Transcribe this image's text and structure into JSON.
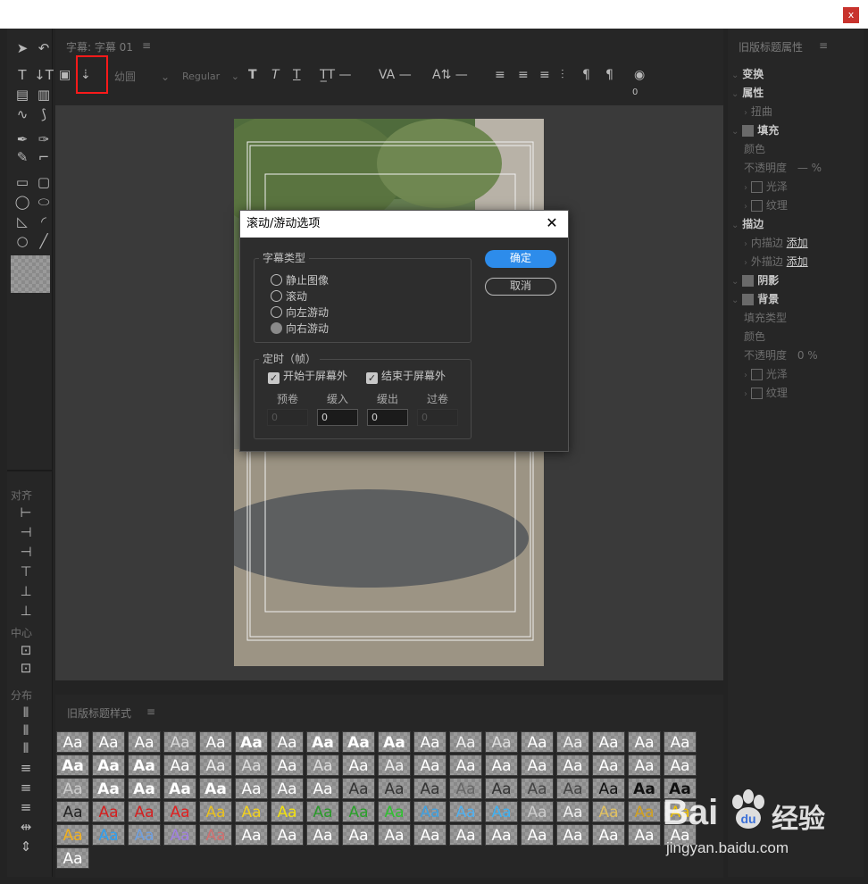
{
  "window": {
    "close_label": "x"
  },
  "title_panel": {
    "tab_label": "字幕: 字幕 01",
    "menu_glyph": "≡",
    "font_family": "幼圆",
    "font_style": "Regular",
    "kerning_value": "0"
  },
  "right_panel": {
    "title": "旧版标题属性",
    "menu_glyph": "≡",
    "items": [
      {
        "label": "变换",
        "kind": "head"
      },
      {
        "label": "属性",
        "kind": "head"
      },
      {
        "label": "扭曲",
        "kind": "sub"
      },
      {
        "label": "填充",
        "kind": "head-check"
      },
      {
        "label": "颜色",
        "kind": "field"
      },
      {
        "label": "不透明度",
        "kind": "field",
        "value": "— %"
      },
      {
        "label": "光泽",
        "kind": "sub-check"
      },
      {
        "label": "纹理",
        "kind": "sub-check"
      },
      {
        "label": "描边",
        "kind": "head"
      },
      {
        "label": "内描边",
        "kind": "sub",
        "link": "添加"
      },
      {
        "label": "外描边",
        "kind": "sub",
        "link": "添加"
      },
      {
        "label": "阴影",
        "kind": "head-check"
      },
      {
        "label": "背景",
        "kind": "head-check-on"
      },
      {
        "label": "填充类型",
        "kind": "field"
      },
      {
        "label": "颜色",
        "kind": "field"
      },
      {
        "label": "不透明度",
        "kind": "field",
        "value": "0 %"
      },
      {
        "label": "光泽",
        "kind": "sub-check"
      },
      {
        "label": "纹理",
        "kind": "sub-check"
      }
    ]
  },
  "left_panel": {
    "align_label": "对齐",
    "center_label": "中心",
    "distribute_label": "分布"
  },
  "styles_panel": {
    "title": "旧版标题样式",
    "menu_glyph": "≡",
    "swatch_text": "Aa",
    "swatch_count": 91
  },
  "dialog": {
    "title": "滚动/游动选项",
    "close_glyph": "✕",
    "type_group_label": "字幕类型",
    "options": [
      "静止图像",
      "滚动",
      "向左游动",
      "向右游动"
    ],
    "selected_option": "向右游动",
    "timing_group_label": "定时（帧）",
    "start_offscreen": "开始于屏幕外",
    "end_offscreen": "结束于屏幕外",
    "fields": [
      {
        "label": "预卷",
        "value": "0",
        "enabled": false
      },
      {
        "label": "缓入",
        "value": "0",
        "enabled": true
      },
      {
        "label": "缓出",
        "value": "0",
        "enabled": true
      },
      {
        "label": "过卷",
        "value": "0",
        "enabled": false
      }
    ],
    "ok_label": "确定",
    "cancel_label": "取消"
  },
  "watermark": {
    "brand": "Bai",
    "brand_suffix": "经验",
    "url": "jingyan.baidu.com"
  },
  "colors": {
    "accent": "#2d8ceb",
    "highlight_box": "#ff1a1a",
    "close_button": "#c8332d"
  }
}
